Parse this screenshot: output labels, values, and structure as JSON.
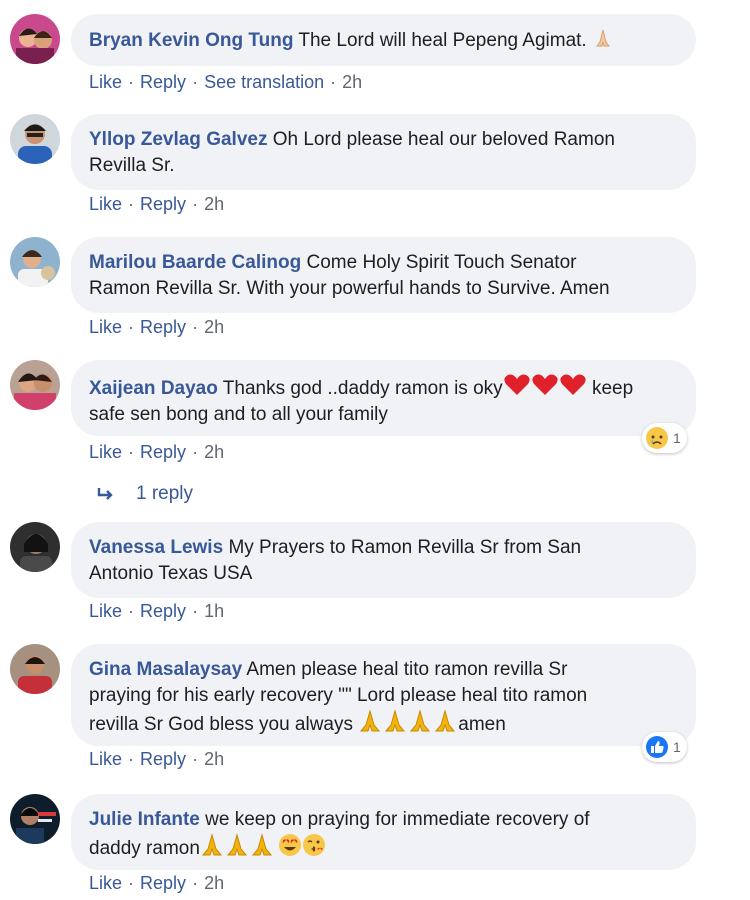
{
  "comments": [
    {
      "author": "Bryan Kevin Ong Tung",
      "text": "The Lord will heal Pepeng Agimat.",
      "like": "Like",
      "reply": "Reply",
      "extra": "See translation",
      "time": "2h"
    },
    {
      "author": "Yllop Zevlag Galvez",
      "text": "Oh Lord please heal our beloved Ramon",
      "text2": "Revilla Sr.",
      "like": "Like",
      "reply": "Reply",
      "time": "2h"
    },
    {
      "author": "Marilou Baarde Calinog",
      "text": "Come Holy Spirit Touch Senator",
      "text2": "Ramon Revilla Sr. With your powerful hands to Survive. Amen",
      "like": "Like",
      "reply": "Reply",
      "time": "2h"
    },
    {
      "author": "Xaijean Dayao",
      "text": "Thanks god ..daddy ramon is oky",
      "text_after": "keep",
      "text2": "safe sen bong and to all your family",
      "like": "Like",
      "reply": "Reply",
      "time": "2h",
      "reaction_count": "1",
      "replies_label": "1 reply"
    },
    {
      "author": "Vanessa Lewis",
      "text": "My Prayers to Ramon Revilla Sr from San",
      "text2": "Antonio Texas USA",
      "like": "Like",
      "reply": "Reply",
      "time": "1h"
    },
    {
      "author": "Gina Masalaysay",
      "text": "Amen please heal tito ramon revilla Sr",
      "text2": "praying for his early recovery \"\" Lord please heal tito ramon",
      "text3": "revilla Sr God bless you always",
      "text3_after": "amen",
      "like": "Like",
      "reply": "Reply",
      "time": "2h",
      "reaction_count": "1"
    },
    {
      "author": "Julie Infante",
      "text": "we keep on praying for immediate recovery of",
      "text2": "daddy ramon",
      "like": "Like",
      "reply": "Reply",
      "time": "2h"
    }
  ],
  "colors": {
    "link": "#385898",
    "bubble": "#f0f2f5",
    "meta": "#606770"
  },
  "icons": [
    "pray-emoji",
    "heart-emoji",
    "sad-reaction-icon",
    "like-reaction-icon",
    "reply-arrow-icon",
    "heart-eyes-emoji",
    "kiss-emoji"
  ]
}
